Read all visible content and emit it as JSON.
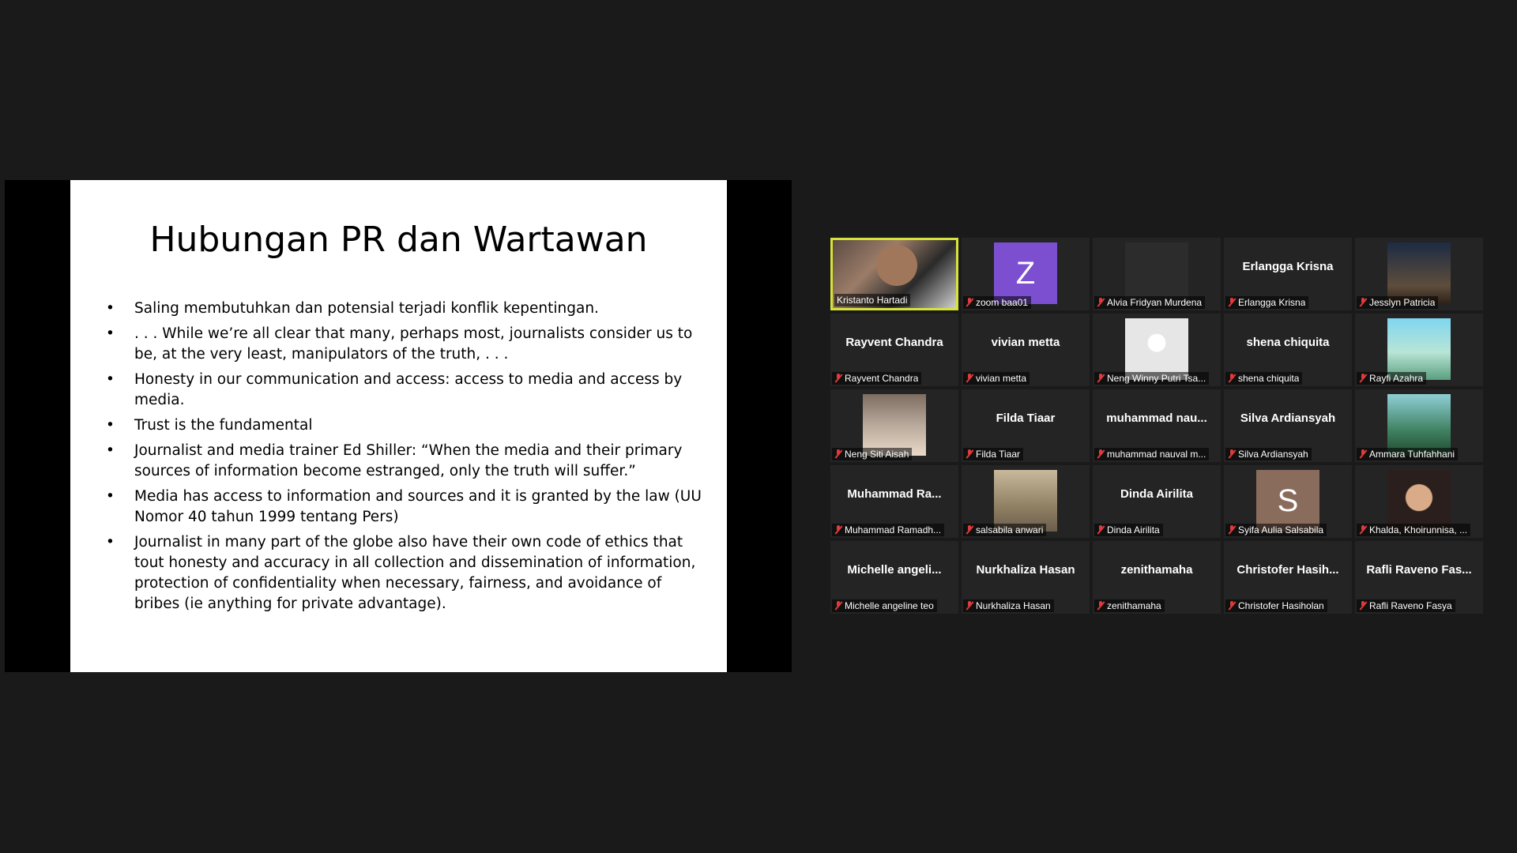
{
  "slide": {
    "title": "Hubungan PR dan Wartawan",
    "bullet_char": "•",
    "bullets": [
      "Saling membutuhkan dan potensial terjadi konflik kepentingan.",
      ". . . While we’re all clear that many, perhaps most, journalists consider us to be, at the very least, manipulators of the truth, . . .",
      "Honesty in our communication and access: access to media and access by media.",
      "Trust is the fundamental",
      "Journalist and media trainer Ed Shiller: “When the media and their primary sources of information become estranged, only the truth will suffer.”",
      "Media has access to information and sources and it is granted by the law (UU Nomor 40 tahun 1999 tentang Pers)",
      "Journalist  in many part of the globe also have their own code of ethics that tout honesty and accuracy in all collection and dissemination of information, protection of confidentiality when necessary, fairness, and avoidance of bribes (ie anything for private advantage)."
    ]
  },
  "participants": [
    {
      "name": "Kristanto Hartadi",
      "big": "",
      "avatar": "video",
      "active": true,
      "muted": false
    },
    {
      "name": "zoom baa01",
      "big": "",
      "avatar": "letter",
      "letter": "Z",
      "color": "#7b4fd0",
      "muted": true
    },
    {
      "name": "Alvia Fridyan Murdena",
      "big": "",
      "avatar": "blank",
      "muted": true
    },
    {
      "name": "Erlangga Krisna",
      "big": "Erlangga Krisna",
      "avatar": "none",
      "muted": true
    },
    {
      "name": "Jesslyn Patricia",
      "big": "",
      "avatar": "city",
      "muted": true
    },
    {
      "name": "Rayvent Chandra",
      "big": "Rayvent Chandra",
      "avatar": "none",
      "muted": true
    },
    {
      "name": "vivian metta",
      "big": "vivian metta",
      "avatar": "none",
      "muted": true
    },
    {
      "name": "Neng Winny Putri Tsa...",
      "big": "",
      "avatar": "girl",
      "muted": true
    },
    {
      "name": "shena chiquita",
      "big": "shena chiquita",
      "avatar": "none",
      "muted": true
    },
    {
      "name": "Rayfi Azahra",
      "big": "",
      "avatar": "sky",
      "muted": true
    },
    {
      "name": "Neng Siti Aisah",
      "big": "",
      "avatar": "room",
      "muted": true
    },
    {
      "name": "Filda Tiaar",
      "big": "Filda Tiaar",
      "avatar": "none",
      "muted": true
    },
    {
      "name": "muhammad nauval m...",
      "big": "muhammad  nau...",
      "avatar": "none",
      "muted": true
    },
    {
      "name": "Silva Ardiansyah",
      "big": "Silva Ardiansyah",
      "avatar": "none",
      "muted": true
    },
    {
      "name": "Ammara Tuhfahhani",
      "big": "",
      "avatar": "beach",
      "muted": true
    },
    {
      "name": "Muhammad Ramadh...",
      "big": "Muhammad  Ra...",
      "avatar": "none",
      "muted": true
    },
    {
      "name": "salsabila anwari",
      "big": "",
      "avatar": "sand",
      "muted": true
    },
    {
      "name": "Dinda Airilita",
      "big": "Dinda Airilita",
      "avatar": "none",
      "muted": true
    },
    {
      "name": "Syifa Aulia Salsabila",
      "big": "",
      "avatar": "letter",
      "letter": "S",
      "color": "#8a6c5c",
      "muted": true
    },
    {
      "name": "Khalda, Khoirunnisa, ...",
      "big": "",
      "avatar": "selfie",
      "muted": true
    },
    {
      "name": "Michelle angeline teo",
      "big": "Michelle  angeli...",
      "avatar": "none",
      "muted": true
    },
    {
      "name": "Nurkhaliza Hasan",
      "big": "Nurkhaliza Hasan",
      "avatar": "none",
      "muted": true
    },
    {
      "name": "zenithamaha",
      "big": "zenithamaha",
      "avatar": "none",
      "muted": true
    },
    {
      "name": "Christofer Hasiholan",
      "big": "Christofer  Hasih...",
      "avatar": "none",
      "muted": true
    },
    {
      "name": "Rafli Raveno Fasya",
      "big": "Rafli Raveno Fas...",
      "avatar": "none",
      "muted": true
    }
  ]
}
